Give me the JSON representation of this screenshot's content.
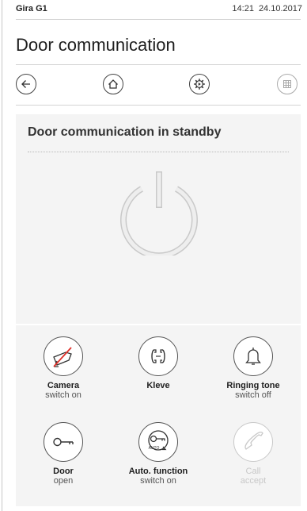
{
  "status_bar": {
    "device": "Gira G1",
    "time": "14:21",
    "date": "24.10.2017"
  },
  "page": {
    "title": "Door communication"
  },
  "nav": {
    "back": "back-arrow-icon",
    "home": "home-icon",
    "settings": "settings-gear-icon",
    "grid": "grid-icon"
  },
  "panel": {
    "title": "Door communication in standby",
    "icon": "power-icon"
  },
  "actions": [
    {
      "label": "Camera",
      "sub": "switch on",
      "icon": "camera-off-icon",
      "enabled": true
    },
    {
      "label": "Kleve",
      "sub": "",
      "icon": "intercom-icon",
      "enabled": true
    },
    {
      "label": "Ringing tone",
      "sub": "switch off",
      "icon": "bell-icon",
      "enabled": true
    },
    {
      "label": "Door",
      "sub": "open",
      "icon": "key-icon",
      "enabled": true
    },
    {
      "label": "Auto. function",
      "sub": "switch on",
      "icon": "auto-key-icon",
      "badge": "AUTO",
      "enabled": true
    },
    {
      "label": "Call",
      "sub": "accept",
      "icon": "phone-handset-icon",
      "enabled": false
    }
  ]
}
